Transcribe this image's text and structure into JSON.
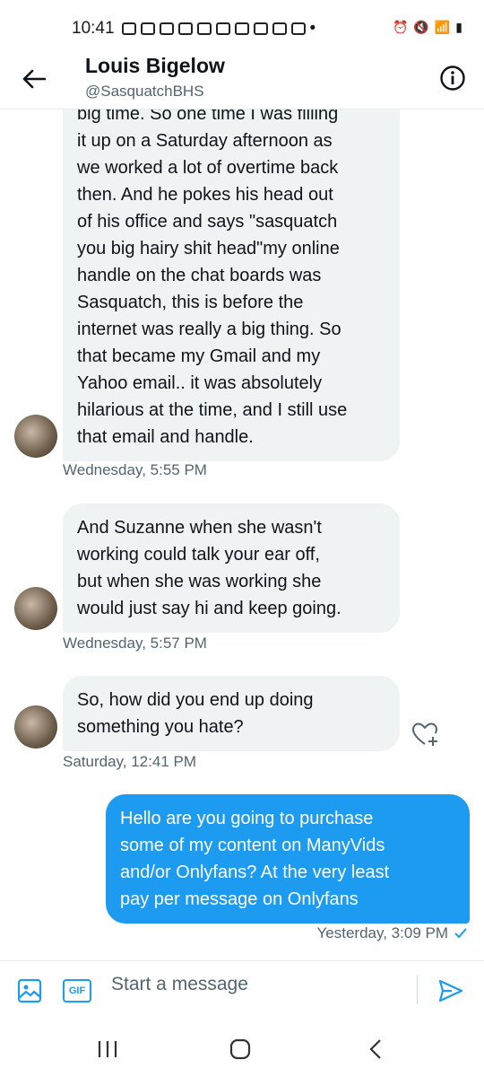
{
  "status_bar": {
    "time": "10:41"
  },
  "header": {
    "name": "Louis Bigelow",
    "handle": "@SasquatchBHS"
  },
  "messages": [
    {
      "lines": [
        "big time. So one time I was filling",
        "it up on a Saturday afternoon as",
        "we worked a lot of overtime back",
        "then. And he pokes his head out",
        "of his office and says \"sasquatch",
        "you big hairy shit head\"my online",
        "handle on the chat boards was",
        "Sasquatch, this is before the",
        "internet was really a big thing. So",
        "that became my Gmail and my",
        "Yahoo email.. it was absolutely",
        "hilarious at the time, and I still use",
        "that email and handle."
      ],
      "timestamp": "Wednesday, 5:55 PM"
    },
    {
      "lines": [
        "And Suzanne when she wasn't",
        "working could talk your ear off,",
        "but when she was working she",
        "would just say hi and keep going."
      ],
      "timestamp": "Wednesday, 5:57 PM"
    },
    {
      "lines": [
        "So, how did you end up doing",
        "something you hate?"
      ],
      "timestamp": "Saturday, 12:41 PM"
    },
    {
      "lines": [
        "Hello are you going to purchase",
        "some of my content on ManyVids",
        "and/or Onlyfans?    At the very least",
        "pay per message on Onlyfans"
      ],
      "timestamp": "Yesterday, 3:09 PM"
    }
  ],
  "composer": {
    "placeholder": "Start a message",
    "gif_label": "GIF"
  },
  "colors": {
    "accent": "#1d9bf0",
    "bubble_in": "#eff3f4"
  }
}
